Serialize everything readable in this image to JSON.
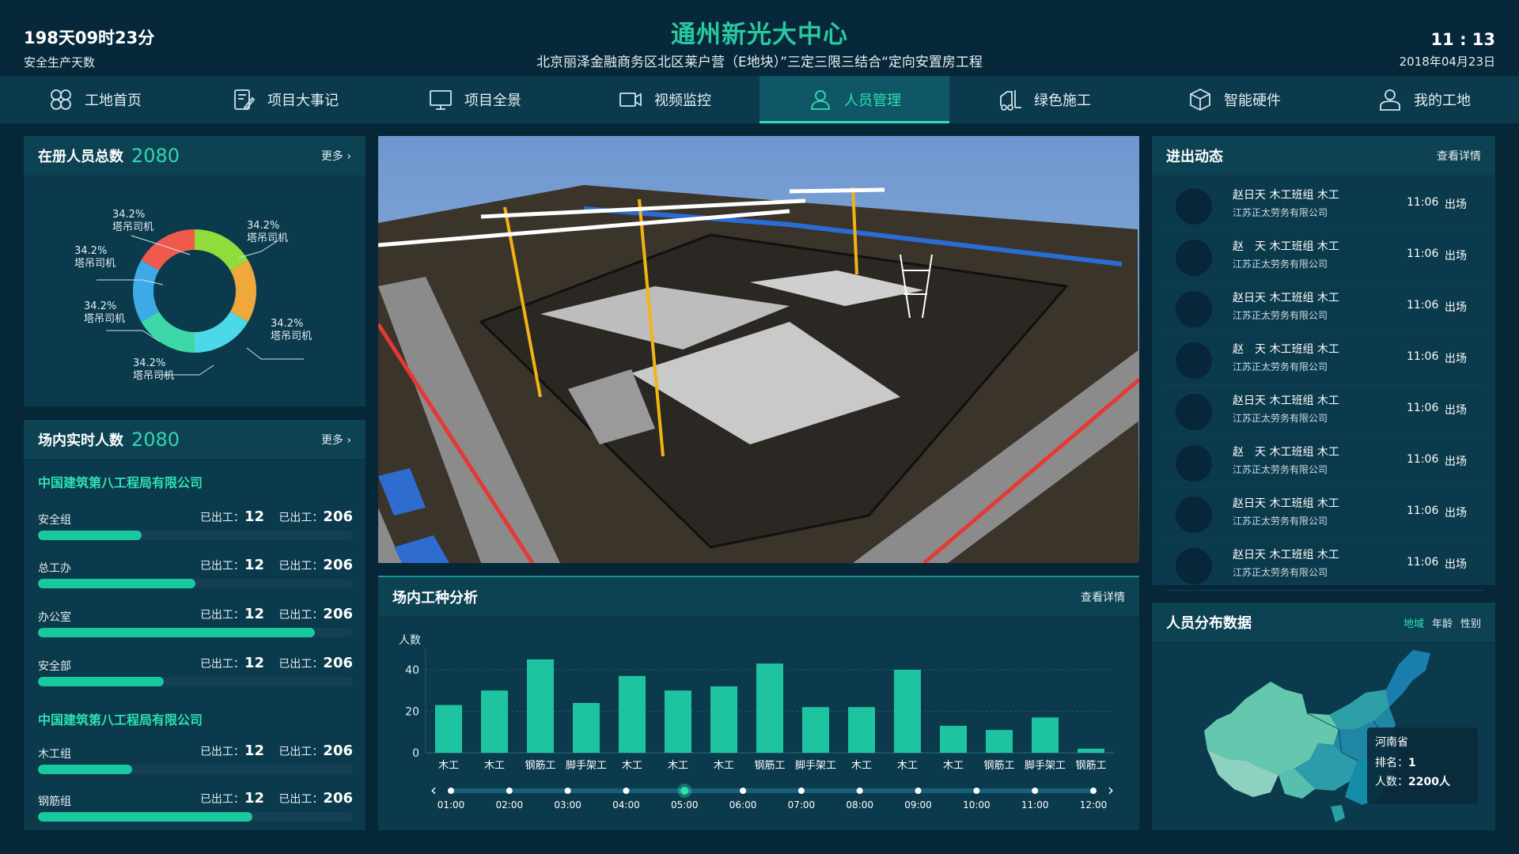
{
  "header": {
    "safe_days": "198天09时23分",
    "safe_label": "安全生产天数",
    "title": "通州新光大中心",
    "subtitle": "北京丽泽金融商务区北区莱户营（E地块）”三定三限三结合“定向安置房工程",
    "time": "11 : 13",
    "date": "2018年04月23日"
  },
  "nav": {
    "items": [
      {
        "label": "工地首页",
        "icon": "grid-flower-icon"
      },
      {
        "label": "项目大事记",
        "icon": "notebook-pen-icon"
      },
      {
        "label": "项目全景",
        "icon": "monitor-icon"
      },
      {
        "label": "视频监控",
        "icon": "video-camera-icon"
      },
      {
        "label": "人员管理",
        "icon": "user-icon",
        "active": true
      },
      {
        "label": "绿色施工",
        "icon": "forklift-icon"
      },
      {
        "label": "智能硬件",
        "icon": "hardware-box-icon"
      },
      {
        "label": "我的工地",
        "icon": "user-outline-icon"
      }
    ]
  },
  "registered": {
    "title": "在册人员总数",
    "count": "2080",
    "more": "更多",
    "slices": [
      {
        "pct": "34.2%",
        "label": "塔吊司机",
        "color": "#8fdc3c",
        "value": 1
      },
      {
        "pct": "34.2%",
        "label": "塔吊司机",
        "color": "#f0a83c",
        "value": 1
      },
      {
        "pct": "34.2%",
        "label": "塔吊司机",
        "color": "#4bd8e8",
        "value": 1
      },
      {
        "pct": "34.2%",
        "label": "塔吊司机",
        "color": "#3ed7a8",
        "value": 1
      },
      {
        "pct": "34.2%",
        "label": "塔吊司机",
        "color": "#3da9e8",
        "value": 1
      },
      {
        "pct": "34.2%",
        "label": "塔吊司机",
        "color": "#f05a4c",
        "value": 1
      }
    ]
  },
  "realtime": {
    "title": "场内实时人数",
    "count": "2080",
    "more": "更多",
    "groups": [
      {
        "company": "中国建筑第八工程局有限公司",
        "rows": [
          {
            "name": "安全组",
            "v1_label": "已出工：",
            "v1": "12",
            "v2_label": "已出工：",
            "v2": "206",
            "progress": 0.33
          },
          {
            "name": "总工办",
            "v1_label": "已出工：",
            "v1": "12",
            "v2_label": "已出工：",
            "v2": "206",
            "progress": 0.5
          },
          {
            "name": "办公室",
            "v1_label": "已出工：",
            "v1": "12",
            "v2_label": "已出工：",
            "v2": "206",
            "progress": 0.88
          },
          {
            "name": "安全部",
            "v1_label": "已出工：",
            "v1": "12",
            "v2_label": "已出工：",
            "v2": "206",
            "progress": 0.4
          }
        ]
      },
      {
        "company": "中国建筑第八工程局有限公司",
        "rows": [
          {
            "name": "木工组",
            "v1_label": "已出工：",
            "v1": "12",
            "v2_label": "已出工：",
            "v2": "206",
            "progress": 0.3
          },
          {
            "name": "钢筋组",
            "v1_label": "已出工：",
            "v1": "12",
            "v2_label": "已出工：",
            "v2": "206",
            "progress": 0.68
          }
        ]
      }
    ]
  },
  "entries": {
    "title": "进出动态",
    "more": "查看详情",
    "items": [
      {
        "name": "赵日天 木工班组 木工",
        "company": "江苏正太劳务有限公司",
        "time": "11:06",
        "status": "出场"
      },
      {
        "name": "赵　天 木工班组 木工",
        "company": "江苏正太劳务有限公司",
        "time": "11:06",
        "status": "出场"
      },
      {
        "name": "赵日天 木工班组 木工",
        "company": "江苏正太劳务有限公司",
        "time": "11:06",
        "status": "出场"
      },
      {
        "name": "赵　天 木工班组 木工",
        "company": "江苏正太劳务有限公司",
        "time": "11:06",
        "status": "出场"
      },
      {
        "name": "赵日天 木工班组 木工",
        "company": "江苏正太劳务有限公司",
        "time": "11:06",
        "status": "出场"
      },
      {
        "name": "赵　天 木工班组 木工",
        "company": "江苏正太劳务有限公司",
        "time": "11:06",
        "status": "出场"
      },
      {
        "name": "赵日天 木工班组 木工",
        "company": "江苏正太劳务有限公司",
        "time": "11:06",
        "status": "出场"
      },
      {
        "name": "赵日天 木工班组 木工",
        "company": "江苏正太劳务有限公司",
        "time": "11:06",
        "status": "出场"
      }
    ]
  },
  "work_analysis": {
    "title": "场内工种分析",
    "more": "查看详情"
  },
  "chart_data": {
    "type": "bar",
    "ylabel": "人数",
    "ylim": [
      0,
      48
    ],
    "yticks": [
      0,
      20,
      40
    ],
    "categories": [
      "木工",
      "木工",
      "钢筋工",
      "脚手架工",
      "木工",
      "木工",
      "木工",
      "钢筋工",
      "脚手架工",
      "木工",
      "木工",
      "木工",
      "钢筋工",
      "脚手架工",
      "钢筋工"
    ],
    "values": [
      23,
      30,
      45,
      24,
      37,
      30,
      32,
      43,
      22,
      22,
      40,
      13,
      11,
      17,
      2
    ],
    "bar_color": "#1ec4a0",
    "grid": true,
    "timeline": {
      "times": [
        "01:00",
        "02:00",
        "03:00",
        "04:00",
        "05:00",
        "06:00",
        "07:00",
        "08:00",
        "09:00",
        "10:00",
        "11:00",
        "12:00"
      ],
      "active_index": 4
    }
  },
  "distribution": {
    "title": "人员分布数据",
    "tabs": [
      {
        "label": "地域",
        "active": true
      },
      {
        "label": "年龄"
      },
      {
        "label": "性别"
      }
    ],
    "tooltip": {
      "province": "河南省",
      "rank_label": "排名：",
      "rank": "1",
      "count_label": "人数：",
      "count": "2200人"
    }
  }
}
